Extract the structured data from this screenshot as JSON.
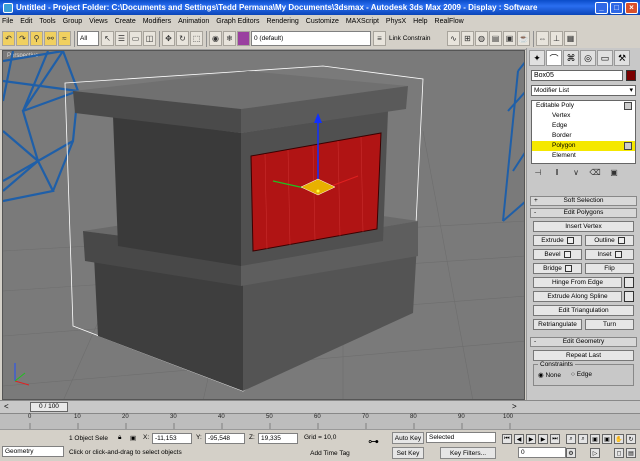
{
  "window": {
    "title": "Untitled   - Project Folder: C:\\Documents and Settings\\Tedd Permana\\My Documents\\3dsmax   - Autodesk 3ds Max  2009      - Display : Software",
    "min": "_",
    "max": "□",
    "close": "×"
  },
  "menu": [
    "File",
    "Edit",
    "Tools",
    "Group",
    "Views",
    "Create",
    "Modifiers",
    "Animation",
    "Graph Editors",
    "Rendering",
    "Customize",
    "MAXScript",
    "PhysX",
    "Help",
    "RealFlow"
  ],
  "toolbar": {
    "filter": "All",
    "layer": "0 (default)",
    "link_constrain": "Link Constrain"
  },
  "viewport": {
    "label": "Perspective"
  },
  "panel": {
    "object_name": "Box05",
    "modifier_list": "Modifier List",
    "stack": [
      {
        "label": "Editable Poly",
        "level": 0
      },
      {
        "label": "Vertex",
        "level": 1
      },
      {
        "label": "Edge",
        "level": 1
      },
      {
        "label": "Border",
        "level": 1
      },
      {
        "label": "Polygon",
        "level": 1
      },
      {
        "label": "Element",
        "level": 1
      }
    ],
    "soft_selection": "Soft Selection",
    "edit_polygons": "Edit Polygons",
    "insert_vertex": "Insert Vertex",
    "extrude": "Extrude",
    "outline": "Outline",
    "bevel": "Bevel",
    "inset": "Inset",
    "bridge": "Bridge",
    "flip": "Flip",
    "hinge": "Hinge From Edge",
    "extrude_spline": "Extrude Along Spline",
    "edit_triangulation": "Edit Triangulation",
    "retriangulate": "Retriangulate",
    "turn": "Turn",
    "edit_geometry": "Edit Geometry",
    "repeat_last": "Repeat Last",
    "constraints": "Constraints",
    "none": "None",
    "edge": "Edge",
    "plus": "+",
    "minus": "-"
  },
  "time": {
    "slider": "0 / 100",
    "ticks": [
      "0",
      "10",
      "20",
      "30",
      "40",
      "50",
      "60",
      "70",
      "80",
      "90",
      "100"
    ]
  },
  "status": {
    "geometry": "Geometry",
    "selected_count": "1 Object Sele",
    "x_label": "X:",
    "x": "-11,153",
    "y_label": "Y:",
    "y": "-95,548",
    "z_label": "Z:",
    "z": "19,335",
    "grid": "Grid = 10,0",
    "auto_key": "Auto Key",
    "selected": "Selected",
    "set_key": "Set Key",
    "key_filters": "Key Filters...",
    "frame": "0",
    "prompt": "Click or click-and-drag to select objects",
    "add_time_tag": "Add Time Tag"
  }
}
